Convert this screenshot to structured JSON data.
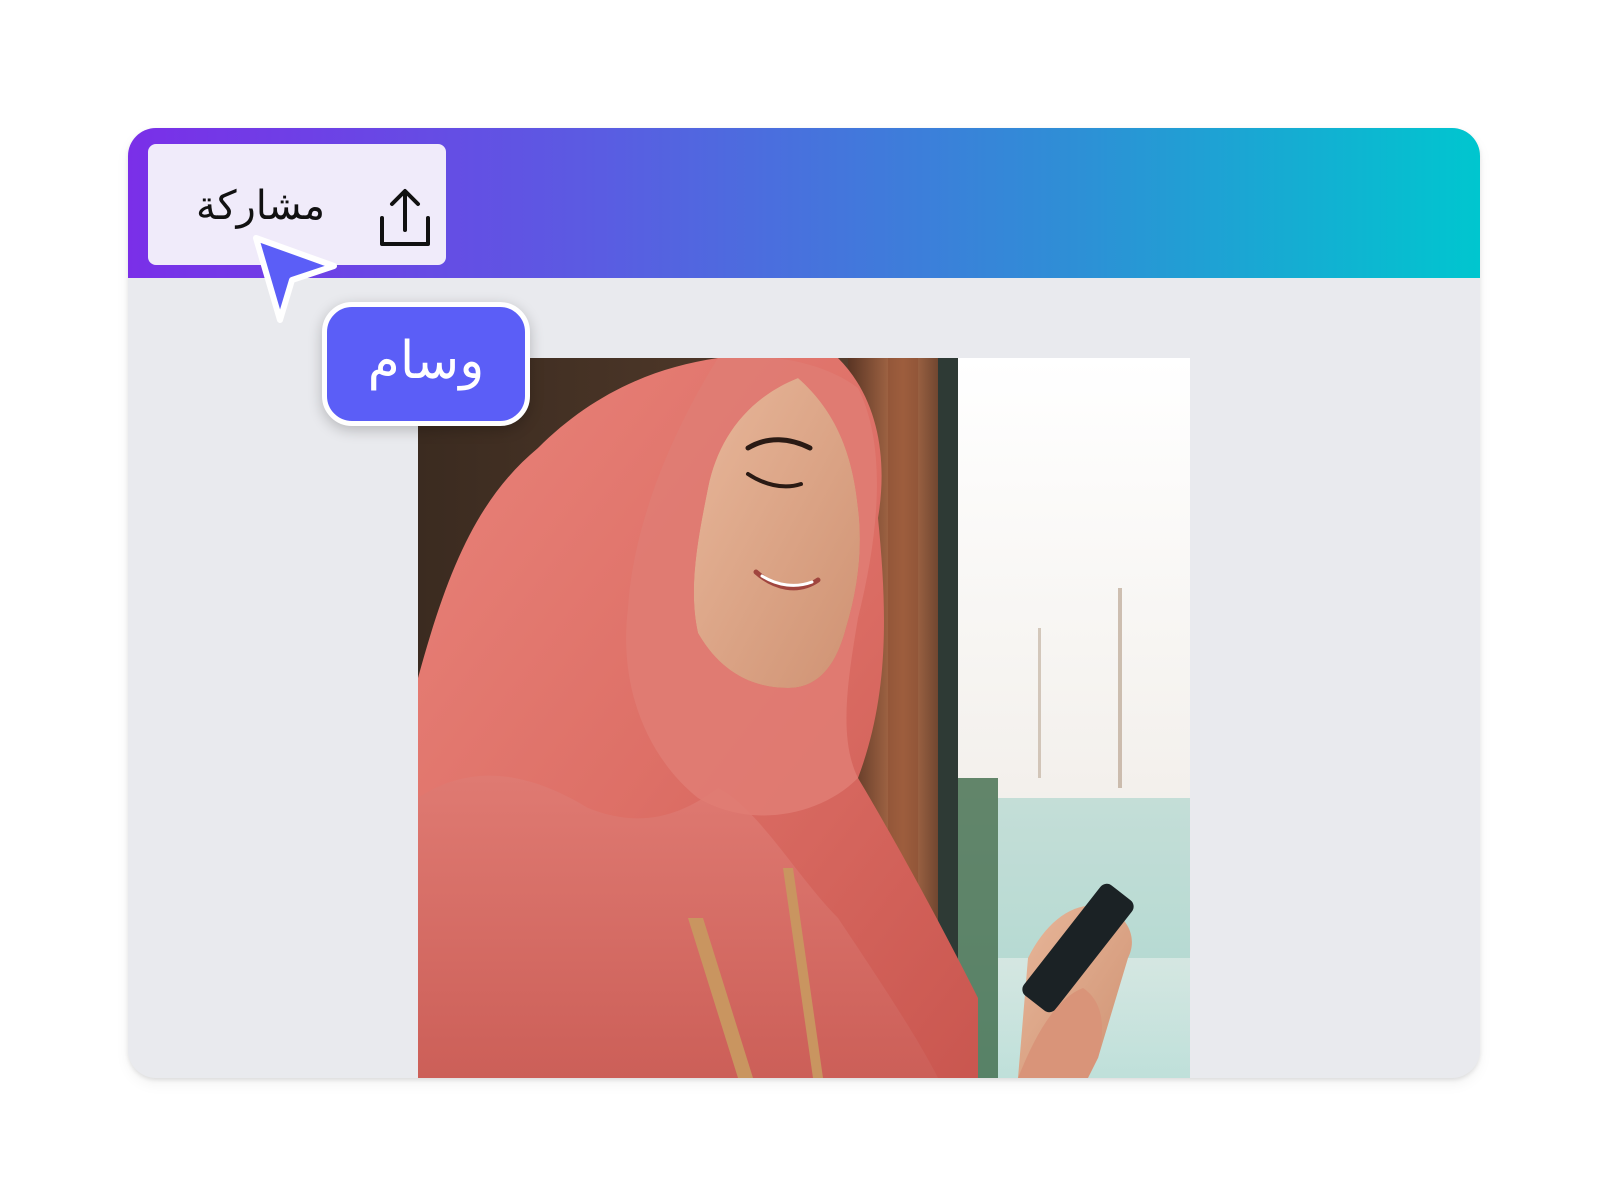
{
  "toolbar": {
    "share_label": "مشاركة",
    "share_icon": "share-upload-icon",
    "gradient": [
      "#7a2fe8",
      "#5a5ce2",
      "#2e8fd6",
      "#00c6cf"
    ]
  },
  "collaborator": {
    "name": "وسام",
    "cursor_icon": "pointer-cursor-icon",
    "color": "#5b5ef7"
  },
  "canvas": {
    "background": "#e9eaee",
    "image": "photo-woman-in-hijab-smiling-at-phone"
  }
}
